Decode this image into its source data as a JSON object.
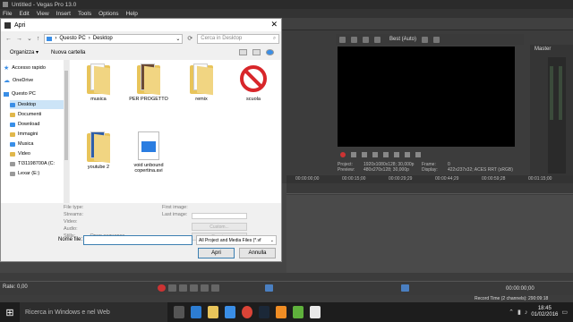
{
  "vegas": {
    "title": "Untitled - Vegas Pro 13.0",
    "menu": [
      "File",
      "Edit",
      "View",
      "Insert",
      "Tools",
      "Options",
      "Help"
    ],
    "preview_quality": "Best (Auto)",
    "master_label": "Master",
    "preview_info": {
      "project_k": "Project:",
      "project_v": "1920x1080x128; 30,000p",
      "preview_k": "Preview:",
      "preview_v": "480x270x128; 30,000p",
      "frame_k": "Frame:",
      "frame_v": "0",
      "display_k": "Display:",
      "display_v": "422x237x32; ACES RRT (sRGB)"
    },
    "ruler": [
      "00:00:00;00",
      "00:00:15;00",
      "00:00:29;29",
      "00:00:44;29",
      "00:00:59;28",
      "00:01:15;00"
    ],
    "rate": "Rate: 0,00",
    "timecode": "00:00:00;00",
    "record_time": "Record Time (2 channels): 290:09:18"
  },
  "dialog": {
    "title": "Apri",
    "breadcrumb": [
      "Questo PC",
      "Desktop"
    ],
    "search_placeholder": "Cerca in Desktop",
    "organize": "Organizza ▾",
    "new_folder": "Nuova cartella",
    "nav_items": [
      {
        "label": "Accesso rapido"
      },
      {
        "label": "OneDrive"
      },
      {
        "label": "Questo PC"
      },
      {
        "label": "Desktop"
      },
      {
        "label": "Documenti"
      },
      {
        "label": "Download"
      },
      {
        "label": "Immagini"
      },
      {
        "label": "Musica"
      },
      {
        "label": "Video"
      },
      {
        "label": "TI31198700A (C:"
      },
      {
        "label": "Lexar (E:)"
      }
    ],
    "files": [
      {
        "name": "musica",
        "kind": "folder"
      },
      {
        "name": "PER PROGETTO",
        "kind": "folder-photo"
      },
      {
        "name": "remix",
        "kind": "folder"
      },
      {
        "name": "scuola",
        "kind": "prohibited"
      },
      {
        "name": "youtube 2",
        "kind": "folder-blue"
      },
      {
        "name": "void unbound copertina.avi",
        "kind": "video"
      }
    ],
    "meta": {
      "file_type": "File type:",
      "streams": "Streams:",
      "video": "Video:",
      "audio": "Audio:",
      "stills": "Stills:",
      "stills_value": "Open sequence",
      "first_image": "First image:",
      "last_image": "Last image:",
      "custom_btn": "Custom...",
      "reset_btn": "Reset..."
    },
    "name_label": "Nome file:",
    "name_value": "",
    "filter_value": "All Project and Media Files (*.vf",
    "open_button": "Apri",
    "cancel_button": "Annulla"
  },
  "taskbar": {
    "search": "Ricerca in Windows e nel Web",
    "time": "18:45",
    "date": "01/02/2016"
  },
  "colors": {
    "accent": "#3c7fb1",
    "folder": "#e8c45a"
  }
}
